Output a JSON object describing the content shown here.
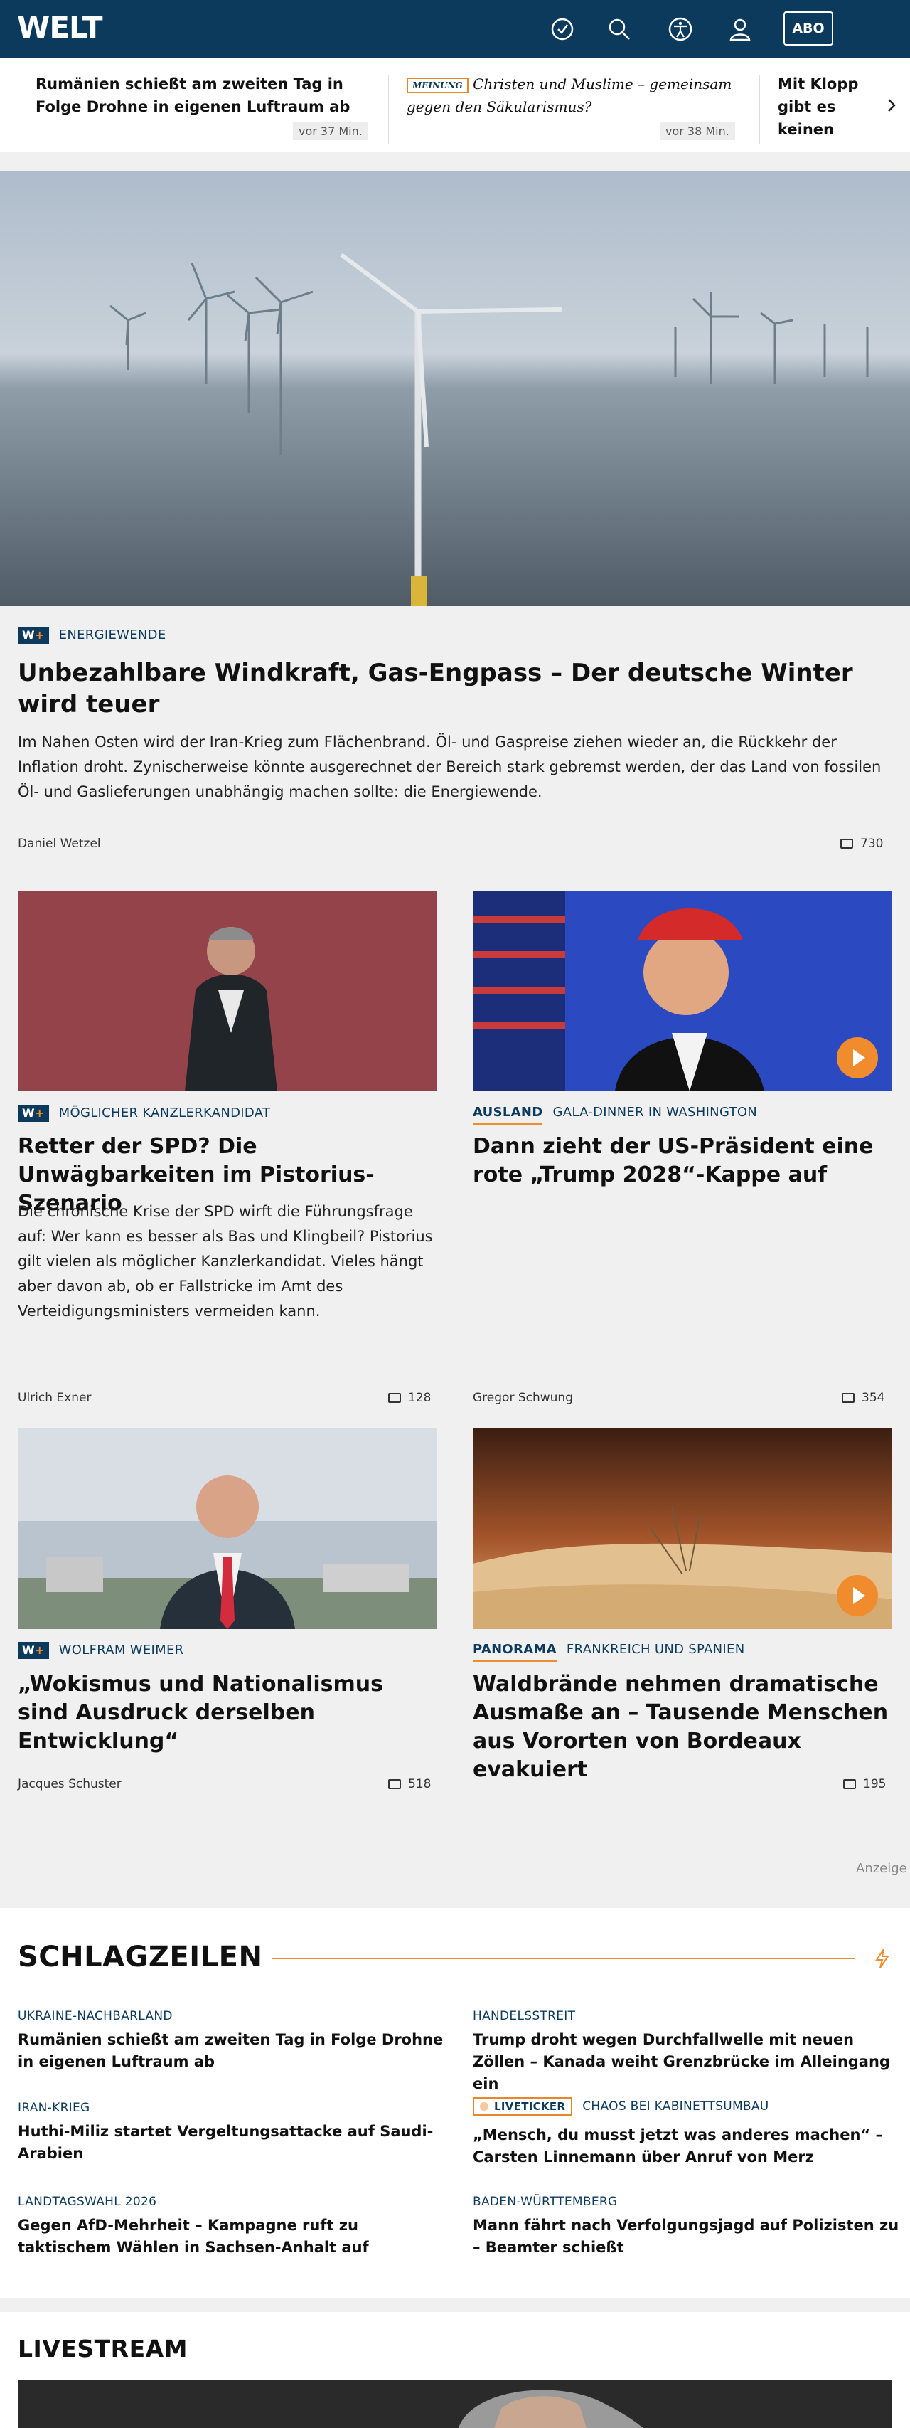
{
  "header": {
    "logo": "WELT",
    "icons": [
      "clock-icon",
      "search-icon",
      "accessibility-icon",
      "user-icon"
    ],
    "abo_label": "ABO"
  },
  "ticker": {
    "items": [
      {
        "title": "Rumänien schießt am zweiten Tag in Folge Drohne in eigenen Luftraum ab",
        "time": "vor 37 Min."
      },
      {
        "badge": "MEINUNG",
        "title": "Christen und Muslime – gemeinsam gegen den Säkularismus?",
        "time": "vor 38 Min."
      },
      {
        "title": "Mit Klopp gibt es keinen Weltmeister... ben danach",
        "time": ""
      }
    ]
  },
  "hero": {
    "badge_w": "W",
    "badge_plus": "+",
    "category": "ENERGIEWENDE",
    "title": "Unbezahlbare Windkraft, Gas-Engpass – Der deutsche Winter wird teuer",
    "teaser": "Im Nahen Osten wird der Iran-Krieg zum Flächenbrand. Öl- und Gaspreise ziehen wieder an, die Rückkehr der Inflation droht. Zynischerweise könnte ausgerechnet der Bereich stark gebremst werden, der das Land von fossilen Öl- und Gaslieferungen unabhängig machen sollte: die Energiewende.",
    "author": "Daniel Wetzel",
    "comments": "730"
  },
  "cards": [
    {
      "badge": "W+",
      "label": "",
      "category": "MÖGLICHER KANZLERKANDIDAT",
      "title": "Retter der SPD? Die Unwägbarkeiten im Pistorius-Szenario",
      "teaser": "Die chronische Krise der SPD wirft die Führungsfrage auf: Wer kann es besser als Bas und Klingbeil? Pistorius gilt vielen als möglicher Kanzlerkandidat. Vieles hängt aber davon ab, ob er Fallstricke im Amt des Verteidigungsministers vermeiden kann.",
      "author": "Ulrich Exner",
      "comments": "128"
    },
    {
      "badge": "",
      "label": "AUSLAND",
      "category": "GALA-DINNER IN WASHINGTON",
      "title": "Dann zieht der US-Präsident eine rote „Trump 2028“-Kappe auf",
      "teaser": "",
      "author": "Gregor Schwung",
      "comments": "354"
    },
    {
      "badge": "W+",
      "label": "",
      "category": "WOLFRAM WEIMER",
      "title": "„Wokismus und Nationalismus sind Ausdruck derselben Entwicklung“",
      "teaser": "",
      "author": "Jacques Schuster",
      "comments": "518"
    },
    {
      "badge": "",
      "label": "PANORAMA",
      "category": "FRANKREICH UND SPANIEN",
      "title": "Waldbrände nehmen dramatische Ausmaße an – Tausende Menschen aus Vororten von Bordeaux evakuiert",
      "teaser": "",
      "author": "",
      "comments": "195"
    }
  ],
  "ad_label": "Anzeige",
  "schlagzeilen": {
    "title": "SCHLAGZEILEN",
    "items": [
      {
        "category": "UKRAINE-NACHBARLAND",
        "title": "Rumänien schießt am zweiten Tag in Folge Drohne in eigenen Luftraum ab"
      },
      {
        "category": "HANDELSSTREIT",
        "title": "Trump droht wegen Durchfallwelle mit neuen Zöllen – Kanada weiht Grenzbrücke im Alleingang ein"
      },
      {
        "category": "IRAN-KRIEG",
        "title": "Huthi-Miliz startet Vergeltungsattacke auf Saudi-Arabien"
      },
      {
        "badge": "LIVETICKER",
        "category": "CHAOS BEI KABINETTSUMBAU",
        "title": "„Mensch, du musst jetzt was anderes machen“ – Carsten Linnemann über Anruf von Merz"
      },
      {
        "category": "LANDTAGSWAHL 2026",
        "title": "Gegen AfD-Mehrheit – Kampagne ruft zu taktischem Wählen in Sachsen-Anhalt auf"
      },
      {
        "category": "BADEN-WÜRTTEMBERG",
        "title": "Mann fährt nach Verfolgungsjagd auf Polizisten zu – Beamter schießt"
      }
    ]
  },
  "livestream": {
    "title": "LIVESTREAM"
  },
  "colors": {
    "brand": "#0b3a5c",
    "accent": "#f08c2e"
  }
}
